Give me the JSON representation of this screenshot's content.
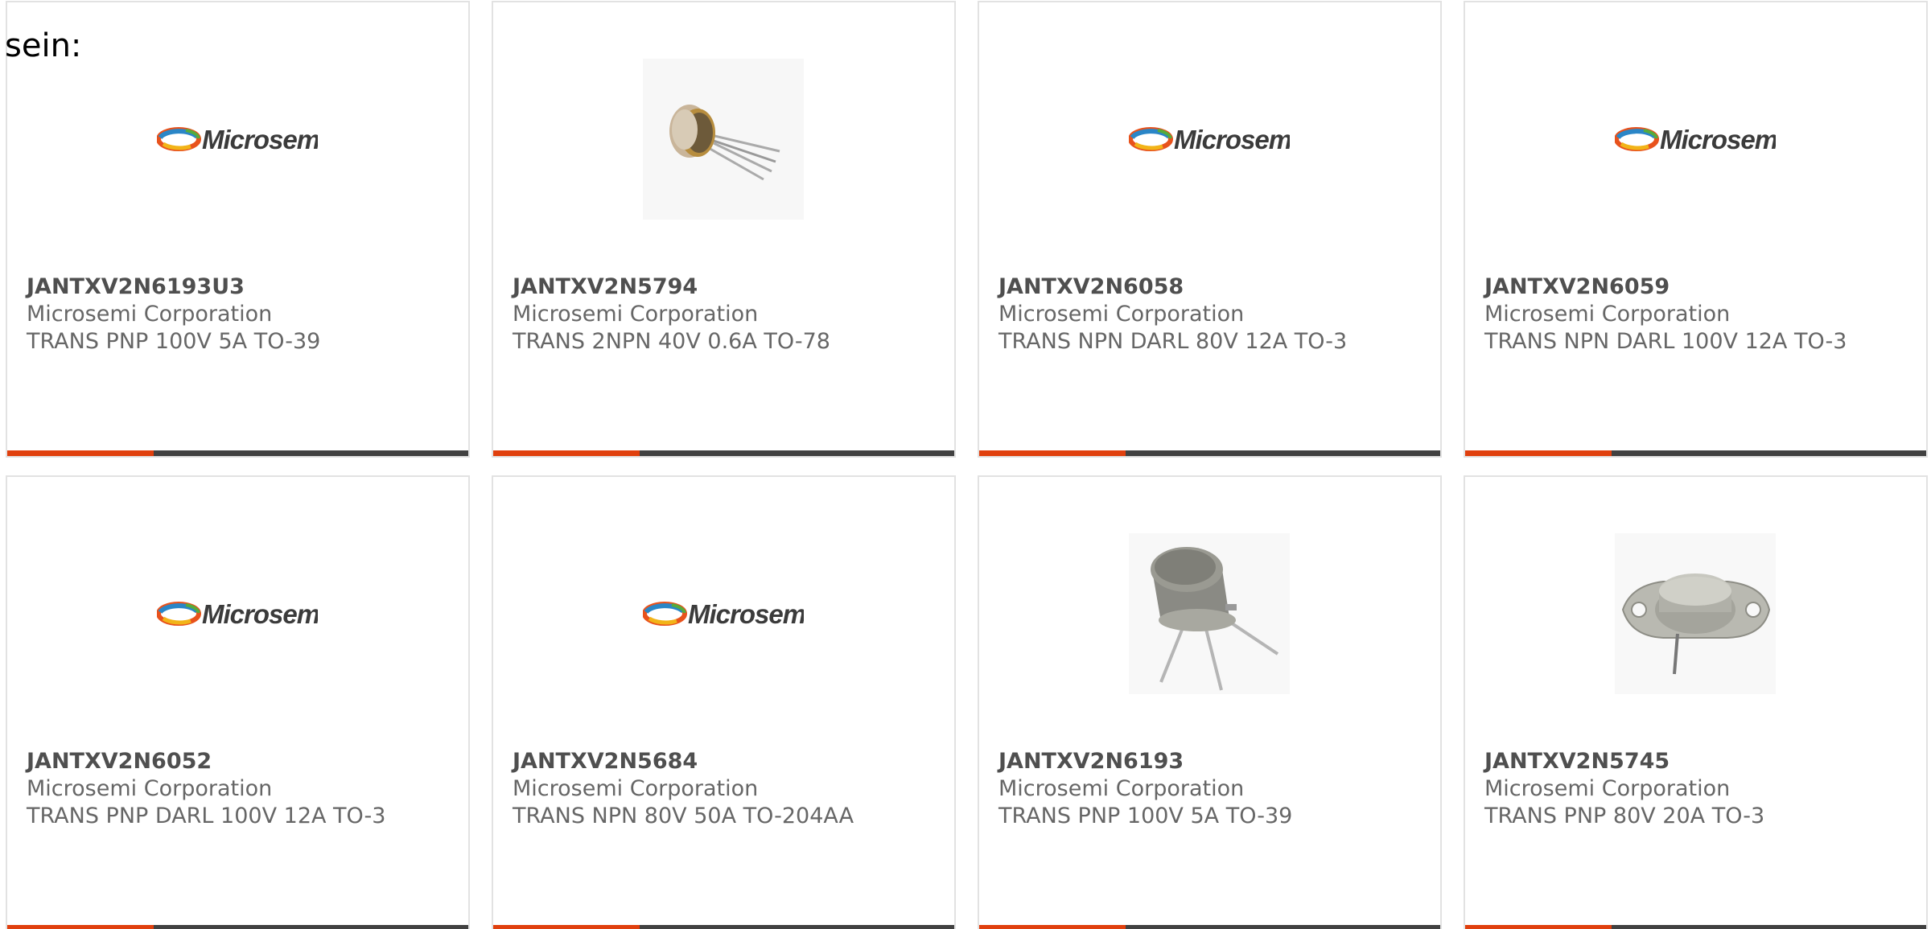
{
  "intro_text": "sein:",
  "colors": {
    "accent": "#e0400e",
    "bar": "#414141",
    "border": "#e2e2e2",
    "part_number": "#4f4f4f",
    "text": "#666666"
  },
  "logo_text": "Microsemi",
  "products": [
    {
      "part_number": "JANTXV2N6193U3",
      "manufacturer": "Microsemi Corporation",
      "description": "TRANS PNP 100V 5A TO-39",
      "image": "microsemi-logo"
    },
    {
      "part_number": "JANTXV2N5794",
      "manufacturer": "Microsemi Corporation",
      "description": "TRANS 2NPN 40V 0.6A TO-78",
      "image": "to-78-package-photo"
    },
    {
      "part_number": "JANTXV2N6058",
      "manufacturer": "Microsemi Corporation",
      "description": "TRANS NPN DARL 80V 12A TO-3",
      "image": "microsemi-logo"
    },
    {
      "part_number": "JANTXV2N6059",
      "manufacturer": "Microsemi Corporation",
      "description": "TRANS NPN DARL 100V 12A TO-3",
      "image": "microsemi-logo"
    },
    {
      "part_number": "JANTXV2N6052",
      "manufacturer": "Microsemi Corporation",
      "description": "TRANS PNP DARL 100V 12A TO-3",
      "image": "microsemi-logo"
    },
    {
      "part_number": "JANTXV2N5684",
      "manufacturer": "Microsemi Corporation",
      "description": "TRANS NPN 80V 50A TO-204AA",
      "image": "microsemi-logo"
    },
    {
      "part_number": "JANTXV2N6193",
      "manufacturer": "Microsemi Corporation",
      "description": "TRANS PNP 100V 5A TO-39",
      "image": "to-39-package-photo"
    },
    {
      "part_number": "JANTXV2N5745",
      "manufacturer": "Microsemi Corporation",
      "description": "TRANS PNP 80V 20A TO-3",
      "image": "to-3-package-photo"
    }
  ]
}
